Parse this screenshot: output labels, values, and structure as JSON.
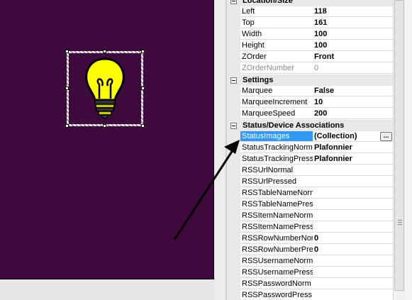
{
  "canvas": {
    "background": "#3e0a3e",
    "component_icon": "light-bulb-icon",
    "bulb_color": "#ffff00"
  },
  "property_grid": {
    "categories": {
      "location": "Location/Size",
      "settings": "Settings",
      "status": "Status/Device Associations"
    },
    "rows": {
      "left": {
        "name": "Left",
        "value": "118"
      },
      "top": {
        "name": "Top",
        "value": "161"
      },
      "width": {
        "name": "Width",
        "value": "100"
      },
      "height": {
        "name": "Height",
        "value": "100"
      },
      "zorder": {
        "name": "ZOrder",
        "value": "Front"
      },
      "zordernumber": {
        "name": "ZOrderNumber",
        "value": "0"
      },
      "marquee": {
        "name": "Marquee",
        "value": "False"
      },
      "marquee_increment": {
        "name": "MarqueeIncrement",
        "value": "10"
      },
      "marquee_speed": {
        "name": "MarqueeSpeed",
        "value": "200"
      },
      "status_images": {
        "name": "StatusImages",
        "value": "(Collection)",
        "button": "..."
      },
      "status_tracking_norm": {
        "name": "StatusTrackingNorm",
        "value": "Plafonnier"
      },
      "status_tracking_press": {
        "name": "StatusTrackingPress",
        "value": "Plafonnier"
      },
      "rss_url_normal": {
        "name": "RSSUrlNormal",
        "value": ""
      },
      "rss_url_pressed": {
        "name": "RSSUrlPressed",
        "value": ""
      },
      "rss_table_name_norm": {
        "name": "RSSTableNameNorm",
        "value": ""
      },
      "rss_table_name_press": {
        "name": "RSSTableNamePress",
        "value": ""
      },
      "rss_item_name_norm": {
        "name": "RSSItemNameNorm",
        "value": ""
      },
      "rss_item_name_press": {
        "name": "RSSItemNamePress",
        "value": ""
      },
      "rss_row_number_norm": {
        "name": "RSSRowNumberNorm",
        "value": "0"
      },
      "rss_row_number_press": {
        "name": "RSSRowNumberPress",
        "value": "0"
      },
      "rss_username_norm": {
        "name": "RSSUsernameNorm",
        "value": ""
      },
      "rss_username_press": {
        "name": "RSSUsernamePress",
        "value": ""
      },
      "rss_password_norm": {
        "name": "RSSPasswordNorm",
        "value": ""
      },
      "rss_password_press": {
        "name": "RSSPasswordPress",
        "value": ""
      }
    },
    "selection_color": "#3399ff"
  },
  "annotation": {
    "arrow_color": "#000000"
  }
}
